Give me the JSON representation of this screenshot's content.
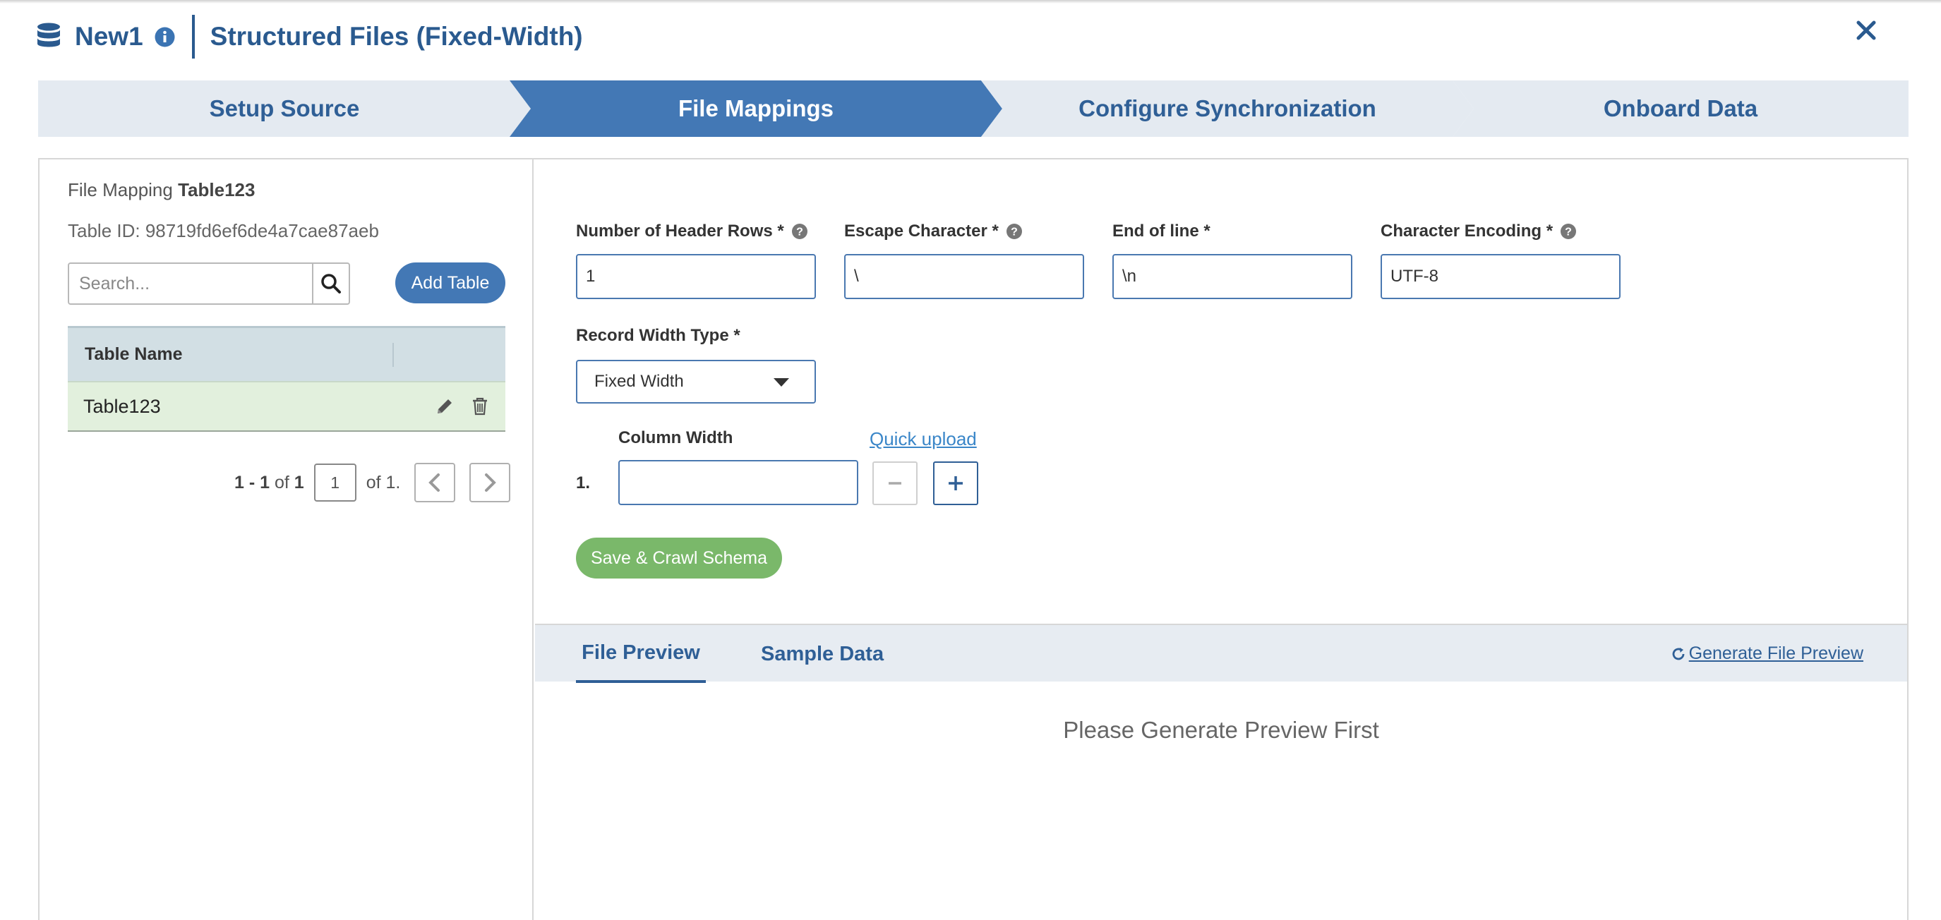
{
  "header": {
    "connection_name": "New1",
    "source_type": "Structured Files (Fixed-Width)"
  },
  "wizard": {
    "steps": [
      {
        "label": "Setup Source",
        "active": false
      },
      {
        "label": "File Mappings",
        "active": true
      },
      {
        "label": "Configure Synchronization",
        "active": false
      },
      {
        "label": "Onboard Data",
        "active": false
      }
    ]
  },
  "left": {
    "file_mapping_prefix": "File Mapping",
    "file_mapping_name": "Table123",
    "table_id": "Table ID: 98719fd6ef6de4a7cae87aeb",
    "search_placeholder": "Search...",
    "add_table_label": "Add Table",
    "table_header": "Table Name",
    "rows": [
      {
        "name": "Table123"
      }
    ],
    "pager": {
      "range": "1 - 1",
      "of_label": "of",
      "total": "1",
      "page": "1",
      "of_pages": "of 1."
    }
  },
  "form": {
    "header_rows": {
      "label": "Number of Header Rows *",
      "value": "1"
    },
    "escape_char": {
      "label": "Escape Character *",
      "value": "\\"
    },
    "end_of_line": {
      "label": "End of line *",
      "value": "\\n"
    },
    "encoding": {
      "label": "Character Encoding *",
      "value": "UTF-8"
    },
    "record_width_type": {
      "label": "Record Width Type *",
      "value": "Fixed Width"
    },
    "column_width": {
      "label": "Column Width",
      "index": "1.",
      "value": ""
    },
    "quick_upload": "Quick upload",
    "save_label": "Save & Crawl Schema"
  },
  "preview": {
    "tabs": [
      {
        "label": "File Preview",
        "active": true
      },
      {
        "label": "Sample Data",
        "active": false
      }
    ],
    "generate_label": " Generate File Preview",
    "empty_text": "Please Generate Preview First"
  },
  "colors": {
    "primary": "#4378b5",
    "heading": "#2a5a8f",
    "success": "#7ab86a",
    "row_selected": "#e2f0dd"
  },
  "icons": [
    "database-icon",
    "info-icon",
    "close-icon",
    "search-icon",
    "edit-icon",
    "trash-icon",
    "chevron-left-icon",
    "chevron-right-icon",
    "question-icon",
    "caret-down-icon",
    "minus-icon",
    "plus-icon",
    "refresh-icon"
  ]
}
